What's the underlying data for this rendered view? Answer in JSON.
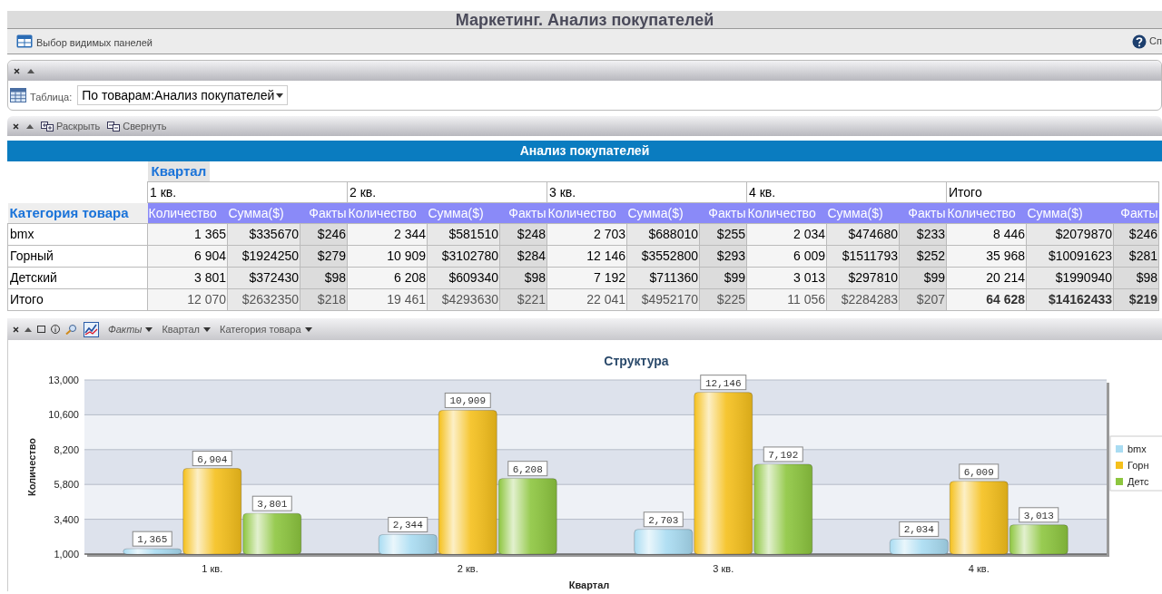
{
  "window": {
    "title": "Маркетинг. Анализ покупателей"
  },
  "toolbar": {
    "panels_button": "Выбор видимых панелей",
    "help_link": "Сп"
  },
  "filter_panel": {
    "label": "Таблица:",
    "select_value": "По товарам:Анализ покупателей"
  },
  "pivot_panel": {
    "actions": [
      {
        "label": "Раскрыть",
        "kind": "expand"
      },
      {
        "label": "Свернуть",
        "kind": "collapse"
      }
    ],
    "pivot": {
      "title": "Анализ покупателей",
      "column_dimension": "Квартал",
      "row_dimension": "Категория товара",
      "groups": [
        {
          "label": "1 кв.",
          "kind": "period",
          "measures": [
            "Количество",
            "Сумма($)",
            "Факты"
          ]
        },
        {
          "label": "2 кв.",
          "kind": "period",
          "measures": [
            "Количество",
            "Сумма($)",
            "Факты"
          ]
        },
        {
          "label": "3 кв.",
          "kind": "period",
          "measures": [
            "Количество",
            "Сумма($)",
            "Факты"
          ]
        },
        {
          "label": "4 кв.",
          "kind": "period",
          "measures": [
            "Количество",
            "Сумма($)",
            "Факты"
          ]
        },
        {
          "label": "Итого",
          "kind": "total",
          "measures": [
            "Количество",
            "Сумма($)",
            "Факты"
          ]
        }
      ],
      "rows": [
        {
          "label": "bmx",
          "kind": "item",
          "cells": [
            "1 365",
            "$335670",
            "$246",
            "2 344",
            "$581510",
            "$248",
            "2 703",
            "$688010",
            "$255",
            "2 034",
            "$474680",
            "$233",
            "8 446",
            "$2079870",
            "$246"
          ]
        },
        {
          "label": "Горный",
          "kind": "item",
          "cells": [
            "6 904",
            "$1924250",
            "$279",
            "10 909",
            "$3102780",
            "$284",
            "12 146",
            "$3552800",
            "$293",
            "6 009",
            "$1511793",
            "$252",
            "35 968",
            "$10091623",
            "$281"
          ]
        },
        {
          "label": "Детский",
          "kind": "item",
          "cells": [
            "3 801",
            "$372430",
            "$98",
            "6 208",
            "$609340",
            "$98",
            "7 192",
            "$711360",
            "$99",
            "3 013",
            "$297810",
            "$99",
            "20 214",
            "$1990940",
            "$98"
          ]
        },
        {
          "label": "Итого",
          "kind": "total",
          "cells": [
            "12 070",
            "$2632350",
            "$218",
            "19 461",
            "$4293630",
            "$221",
            "22 041",
            "$4952170",
            "$225",
            "11 056",
            "$2284283",
            "$207",
            "64 628",
            "$14162433",
            "$219"
          ]
        }
      ]
    }
  },
  "chart_panel": {
    "filters": [
      {
        "label": "Факты",
        "kind": "measure"
      },
      {
        "label": "Квартал",
        "kind": "dimension"
      },
      {
        "label": "Категория товара",
        "kind": "dimension"
      }
    ],
    "chart_data": {
      "type": "bar",
      "title": "Структура",
      "xlabel": "Квартал",
      "ylabel": "Количество",
      "categories": [
        "1 кв.",
        "2 кв.",
        "3 кв.",
        "4 кв."
      ],
      "series": [
        {
          "name": "bmx",
          "color": "#a9dcf2",
          "values": [
            1365,
            2344,
            2703,
            2034
          ]
        },
        {
          "name": "Горн",
          "color": "#f5c01c",
          "values": [
            6904,
            10909,
            12146,
            6009
          ]
        },
        {
          "name": "Детс",
          "color": "#8dc63f",
          "values": [
            3801,
            6208,
            7192,
            3013
          ]
        }
      ],
      "ylim": [
        1000,
        13000
      ],
      "yticks": [
        {
          "value": 1000,
          "label": "1,000"
        },
        {
          "value": 3400,
          "label": "3,400"
        },
        {
          "value": 5800,
          "label": "5,800"
        },
        {
          "value": 8200,
          "label": "8,200"
        },
        {
          "value": 10600,
          "label": "10,600"
        },
        {
          "value": 13000,
          "label": "13,000"
        }
      ],
      "value_labels": [
        [
          "1,365",
          "2,344",
          "2,703",
          "2,034"
        ],
        [
          "6,904",
          "10,909",
          "12,146",
          "6,009"
        ],
        [
          "3,801",
          "6,208",
          "7,192",
          "3,013"
        ]
      ],
      "grid": true,
      "legend": true
    }
  }
}
